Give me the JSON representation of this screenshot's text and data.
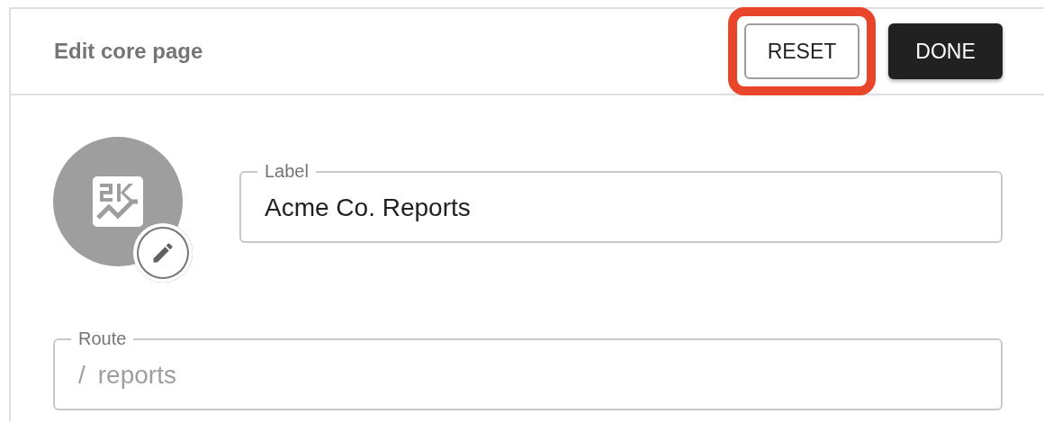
{
  "header": {
    "title": "Edit core page",
    "buttons": [
      {
        "label": "RESET",
        "kind": "outlined",
        "highlighted": true
      },
      {
        "label": "DONE",
        "kind": "filled",
        "highlighted": false
      }
    ]
  },
  "form": {
    "label_field": {
      "label": "Label",
      "value": "Acme Co. Reports"
    },
    "route_field": {
      "label": "Route",
      "prefix": "/",
      "placeholder": "reports"
    }
  }
}
